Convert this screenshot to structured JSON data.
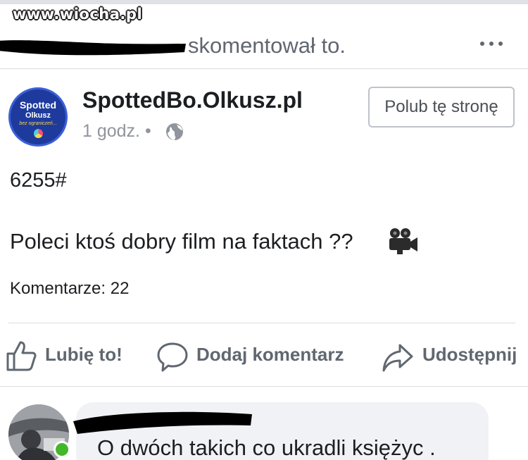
{
  "watermark": {
    "text": "www.wiocha.pl"
  },
  "activity": {
    "text": "skomentował to.",
    "more_icon": "more-horizontal-icon"
  },
  "post": {
    "page_name": "SpottedBo.Olkusz.pl",
    "timestamp": "1 godz.",
    "separator": "•",
    "privacy_icon": "globe-icon",
    "like_page_label": "Polub tę stronę",
    "avatar": {
      "line1": "Spotted",
      "line2": "Olkusz",
      "line3": "bez ograniczeń..."
    },
    "tag": "6255#",
    "text": "Poleci ktoś dobry film na faktach ??",
    "emoji": "movie-camera-icon",
    "comments_count": "Komentarze: 22"
  },
  "actions": {
    "like": {
      "label": "Lubię to!",
      "icon": "thumbs-up-icon"
    },
    "comment": {
      "label": "Dodaj komentarz",
      "icon": "comment-bubble-icon"
    },
    "share": {
      "label": "Udostępnij",
      "icon": "share-arrow-icon"
    }
  },
  "comment": {
    "text": "O dwóch takich co ukradli księżyc .",
    "online_color": "#42b72a"
  },
  "colors": {
    "text": "#1c1e21",
    "secondary": "#606770",
    "meta": "#90949c",
    "divider": "#dadde1",
    "bubble": "#f0f2f5",
    "page_avatar_bg": "#1e3a9c"
  }
}
